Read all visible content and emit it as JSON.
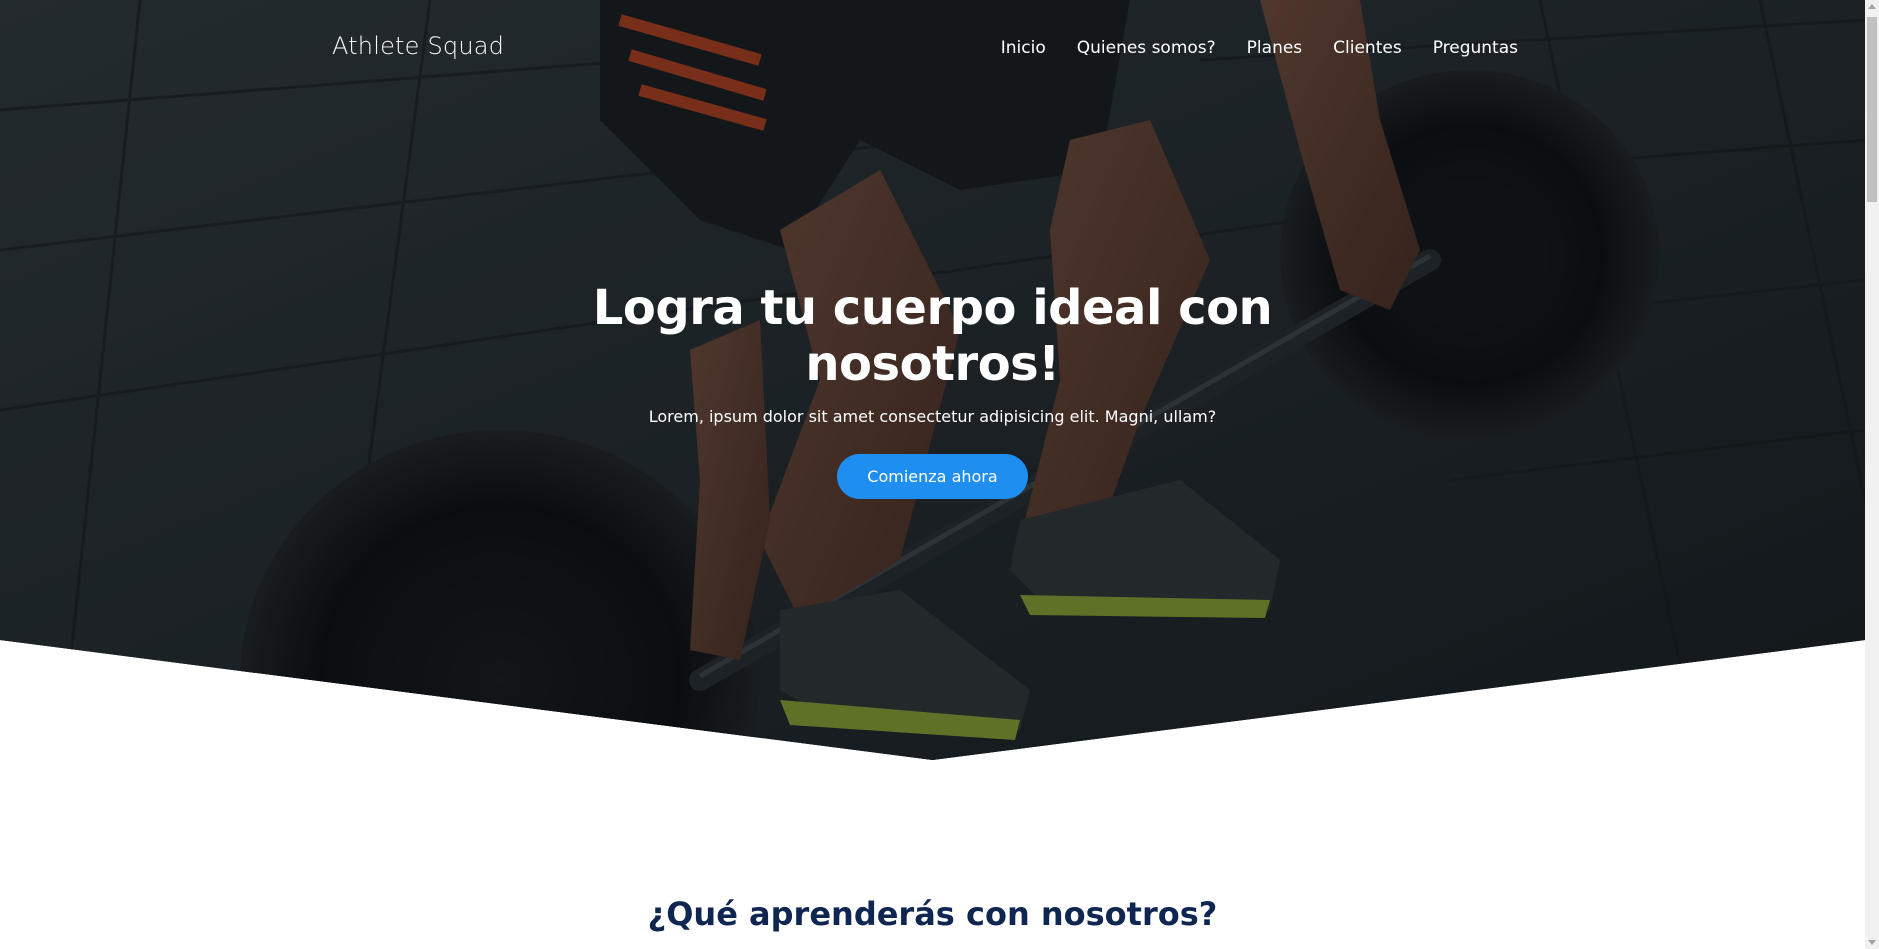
{
  "navbar": {
    "brand": "Athlete Squad",
    "links": [
      "Inicio",
      "Quienes somos?",
      "Planes",
      "Clientes",
      "Preguntas"
    ]
  },
  "hero": {
    "title": "Logra tu cuerpo ideal con nosotros!",
    "subtitle": "Lorem, ipsum dolor sit amet consectetur adipisicing elit. Magni, ullam?",
    "cta_label": "Comienza ahora",
    "background_image": "barbell-deadlift-photo"
  },
  "section": {
    "title": "¿Qué aprenderás con nosotros?"
  },
  "colors": {
    "accent": "#1f8ef1",
    "heading": "#0f2650",
    "overlay": "#0b1216"
  }
}
